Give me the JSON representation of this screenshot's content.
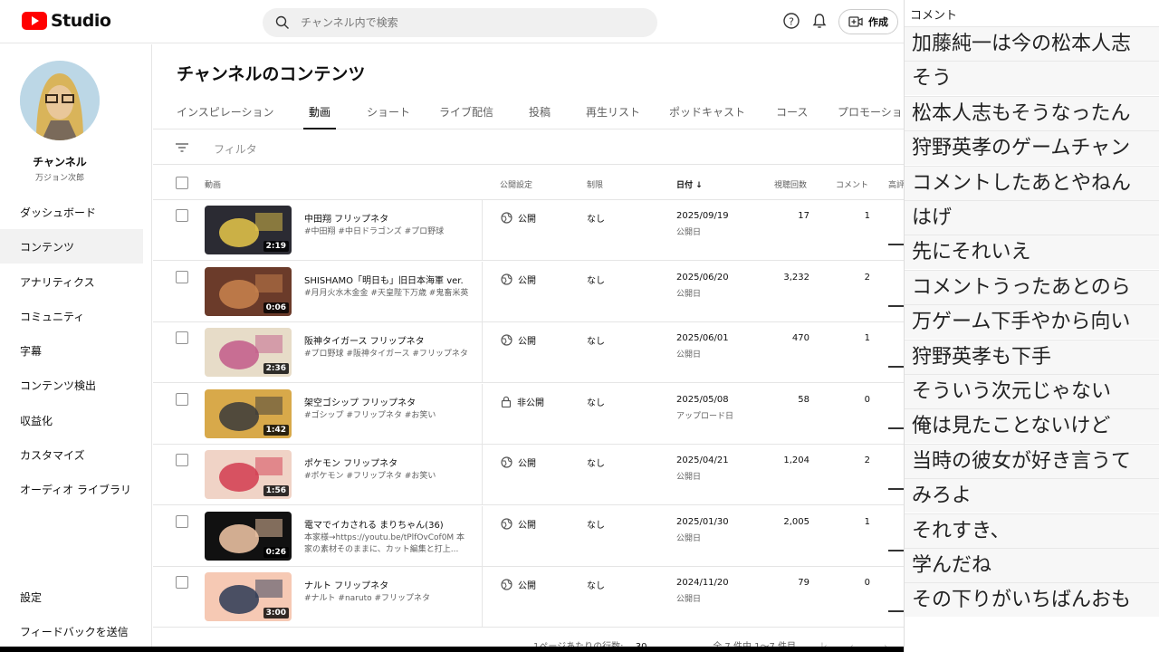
{
  "header": {
    "logo_text": "Studio",
    "search_placeholder": "チャンネル内で検索",
    "create_label": "作成"
  },
  "channel": {
    "name": "チャンネル",
    "handle": "万ジョン次郎"
  },
  "sidebar": {
    "items": [
      {
        "label": "ダッシュボード",
        "active": false
      },
      {
        "label": "コンテンツ",
        "active": true
      },
      {
        "label": "アナリティクス",
        "active": false
      },
      {
        "label": "コミュニティ",
        "active": false
      },
      {
        "label": "字幕",
        "active": false
      },
      {
        "label": "コンテンツ検出",
        "active": false
      },
      {
        "label": "収益化",
        "active": false
      },
      {
        "label": "カスタマイズ",
        "active": false
      },
      {
        "label": "オーディオ ライブラリ",
        "active": false
      }
    ],
    "settings_label": "設定",
    "feedback_label": "フィードバックを送信"
  },
  "main": {
    "title": "チャンネルのコンテンツ",
    "tabs": [
      {
        "label": "インスピレーション"
      },
      {
        "label": "動画",
        "active": true
      },
      {
        "label": "ショート"
      },
      {
        "label": "ライブ配信"
      },
      {
        "label": "投稿"
      },
      {
        "label": "再生リスト"
      },
      {
        "label": "ポッドキャスト"
      },
      {
        "label": "コース"
      },
      {
        "label": "プロモーショ"
      }
    ],
    "filter_label": "フィルタ",
    "columns": {
      "video": "動画",
      "visibility": "公開設定",
      "restriction": "制限",
      "date": "日付",
      "views": "視聴回数",
      "comments": "コメント",
      "likes": "高評"
    },
    "rows": [
      {
        "title": "中田翔 フリップネタ",
        "desc": "#中田翔 #中日ドラゴンズ #プロ野球",
        "duration": "2:19",
        "visibility": "公開",
        "restriction": "なし",
        "date": "2025/09/19",
        "date_type": "公開日",
        "views": "17",
        "comments": "1",
        "thumb_color": "#2b2b33",
        "thumb_accent": "#e8c84a"
      },
      {
        "title": "SHISHAMO「明日も」旧日本海軍 ver.",
        "desc": "#月月火水木金金 #天皇陛下万歳 #鬼畜米英",
        "duration": "0:06",
        "visibility": "公開",
        "restriction": "なし",
        "date": "2025/06/20",
        "date_type": "公開日",
        "views": "3,232",
        "comments": "2",
        "thumb_color": "#6b3b2a",
        "thumb_accent": "#c9844e"
      },
      {
        "title": "阪神タイガース フリップネタ",
        "desc": "#プロ野球 #阪神タイガース #フリップネタ",
        "duration": "2:36",
        "visibility": "公開",
        "restriction": "なし",
        "date": "2025/06/01",
        "date_type": "公開日",
        "views": "470",
        "comments": "1",
        "thumb_color": "#e7dcc8",
        "thumb_accent": "#c25b8a"
      },
      {
        "title": "架空ゴシップ フリップネタ",
        "desc": "#ゴシップ #フリップネタ #お笑い",
        "duration": "1:42",
        "visibility": "非公開",
        "restriction": "なし",
        "date": "2025/05/08",
        "date_type": "アップロード日",
        "views": "58",
        "comments": "0",
        "thumb_color": "#d8a94a",
        "thumb_accent": "#3a3a3a"
      },
      {
        "title": "ポケモン フリップネタ",
        "desc": "#ポケモン #フリップネタ #お笑い",
        "duration": "1:56",
        "visibility": "公開",
        "restriction": "なし",
        "date": "2025/04/21",
        "date_type": "公開日",
        "views": "1,204",
        "comments": "2",
        "thumb_color": "#f0d3c6",
        "thumb_accent": "#d23b4f"
      },
      {
        "title": "電マでイカされる まりちゃん(36)",
        "desc": "本家様→https://youtu.be/tPlfOvCof0M 本家の素材そのままに、カット編集と打上...",
        "duration": "0:26",
        "visibility": "公開",
        "restriction": "なし",
        "date": "2025/01/30",
        "date_type": "公開日",
        "views": "2,005",
        "comments": "1",
        "thumb_color": "#111111",
        "thumb_accent": "#f4c9a8"
      },
      {
        "title": "ナルト フリップネタ",
        "desc": "#ナルト #naruto #フリップネタ",
        "duration": "3:00",
        "visibility": "公開",
        "restriction": "なし",
        "date": "2024/11/20",
        "date_type": "公開日",
        "views": "79",
        "comments": "0",
        "thumb_color": "#f6c9b4",
        "thumb_accent": "#2b3a55"
      }
    ],
    "pager": {
      "rows_per_page_label": "1ページあたりの行数:",
      "rows_per_page": "30",
      "range": "全 7 件中 1〜7 件目"
    }
  },
  "comments_panel": {
    "header": "コメント",
    "items": [
      "加藤純一は今の松本人志",
      "そう",
      "松本人志もそうなったん",
      "狩野英孝のゲームチャン",
      "コメントしたあとやねん",
      "はげ",
      "先にそれいえ",
      "コメントうったあとのら",
      "万ゲーム下手やから向い",
      "狩野英孝も下手",
      "そういう次元じゃない",
      "俺は見たことないけど",
      "当時の彼女が好き言うて",
      "みろよ",
      "それすき、",
      "学んだね",
      "その下りがいちばんおも"
    ]
  }
}
